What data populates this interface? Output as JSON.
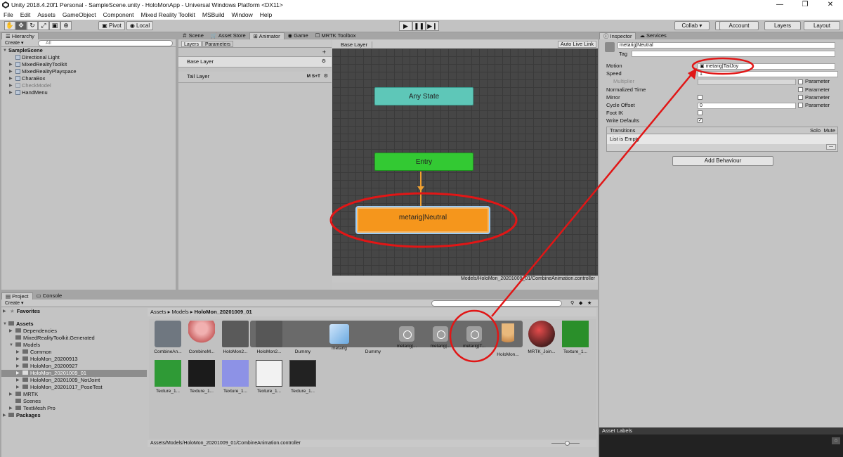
{
  "window": {
    "title": "Unity 2018.4.20f1 Personal - SampleScene.unity - HoloMonApp - Universal Windows Platform <DX11>",
    "minimize": "—",
    "maximize": "❐",
    "close": "✕"
  },
  "menu": [
    "File",
    "Edit",
    "Assets",
    "GameObject",
    "Component",
    "Mixed Reality Toolkit",
    "MSBuild",
    "Window",
    "Help"
  ],
  "toolbar": {
    "pivot": "Pivot",
    "local": "Local",
    "collab": "Collab ▾",
    "account": "Account",
    "layers": "Layers",
    "layout": "Layout"
  },
  "hierarchy": {
    "tab": "Hierarchy",
    "create": "Create ▾",
    "search_placeholder": "All",
    "scene": "SampleScene",
    "items": [
      "Directional Light",
      "MixedRealityToolkit",
      "MixedRealityPlayspace",
      "CharaBox",
      "CheckModel",
      "HandMenu"
    ]
  },
  "center_tabs": {
    "scene": "Scene",
    "asset_store": "Asset Store",
    "animator": "Animator",
    "game": "Game",
    "mrtk": "MRTK Toolbox"
  },
  "animator": {
    "tab_layers": "Layers",
    "tab_parameters": "Parameters",
    "add": "+",
    "base_layer": "Base Layer",
    "tail_layer": "Tail Layer",
    "tail_flags": "M S+T",
    "graph_title": "Base Layer",
    "auto_live_link": "Auto Live Link",
    "nodes": {
      "any_state": "Any State",
      "entry": "Entry",
      "neutral": "metarig|Neutral"
    },
    "footer_path": "Models/HoloMon_20201009_01/CombineAnimation.controller"
  },
  "inspector": {
    "tab_inspector": "Inspector",
    "tab_services": "Services",
    "name": "metarig|Neutral",
    "tag_label": "Tag",
    "rows": {
      "motion": "Motion",
      "motion_value": "metarig|TailJoy",
      "speed": "Speed",
      "speed_value": "1",
      "multiplier": "Multiplier",
      "normalized_time": "Normalized Time",
      "mirror": "Mirror",
      "cycle_offset": "Cycle Offset",
      "cycle_offset_value": "0",
      "foot_ik": "Foot IK",
      "write_defaults": "Write Defaults",
      "parameter": "Parameter"
    },
    "transitions": "Transitions",
    "solo": "Solo",
    "mute": "Mute",
    "list_empty": "List is Empty",
    "list_btn": "—",
    "add_behaviour": "Add Behaviour",
    "asset_labels": "Asset Labels"
  },
  "project": {
    "tab_project": "Project",
    "tab_console": "Console",
    "create": "Create ▾",
    "favorites": "Favorites",
    "assets": "Assets",
    "tree": [
      "Dependencies",
      "MixedRealityToolkit.Generated",
      "Models",
      "Common",
      "HoloMon_20200913",
      "HoloMon_20200927",
      "HoloMon_20201009_01",
      "HoloMon_20201009_NotJoint",
      "HoloMon_20201017_PoseTest",
      "MRTK",
      "Scenes",
      "TextMesh Pro"
    ],
    "packages": "Packages",
    "breadcrumb": [
      "Assets",
      "Models",
      "HoloMon_20201009_01"
    ],
    "assets_row1": [
      "CombineAn...",
      "CombineM...",
      "HoloMon2...",
      "HoloMon2...",
      "Dummy",
      "metarig",
      "Dummy",
      "metarig|...",
      "metarig|...",
      "metarig|T...",
      "HoloMon...",
      "MRTK_Join...",
      "Texture_1..."
    ],
    "assets_row2": [
      "Texture_1...",
      "Texture_1...",
      "Texture_1...",
      "Texture_1...",
      "Texture_1..."
    ],
    "status_path": "Assets/Models/HoloMon_20201009_01/CombineAnimation.controller"
  },
  "colors": {
    "any_state": "#58c2b3",
    "entry": "#2dc52d",
    "neutral": "#f28d10",
    "annotation": "#e11616"
  }
}
